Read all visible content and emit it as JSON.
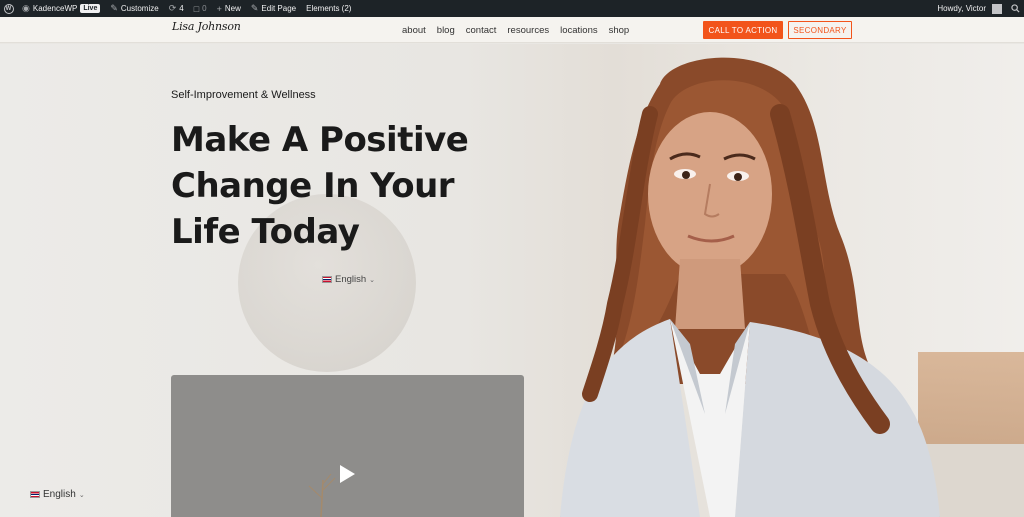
{
  "admin_bar": {
    "site_name": "KadenceWP",
    "live_badge": "Live",
    "customize": "Customize",
    "updates_count": "4",
    "comments_count": "0",
    "new": "New",
    "edit_page": "Edit Page",
    "elements": "Elements (2)",
    "greeting": "Howdy, Victor"
  },
  "header": {
    "logo_text": "Lisa Johnson",
    "nav": [
      "about",
      "blog",
      "contact",
      "resources",
      "locations",
      "shop"
    ],
    "primary_button": "CALL TO ACTION",
    "secondary_button": "SECONDARY"
  },
  "hero": {
    "kicker": "Self-Improvement & Wellness",
    "headline": "Make A Positive Change In Your Life Today",
    "language_inline": "English",
    "language_footer": "English"
  },
  "colors": {
    "accent": "#f2541b",
    "admin_bar": "#1d2327",
    "header_bg": "#f5f3ef",
    "headline": "#1a1a1a"
  }
}
